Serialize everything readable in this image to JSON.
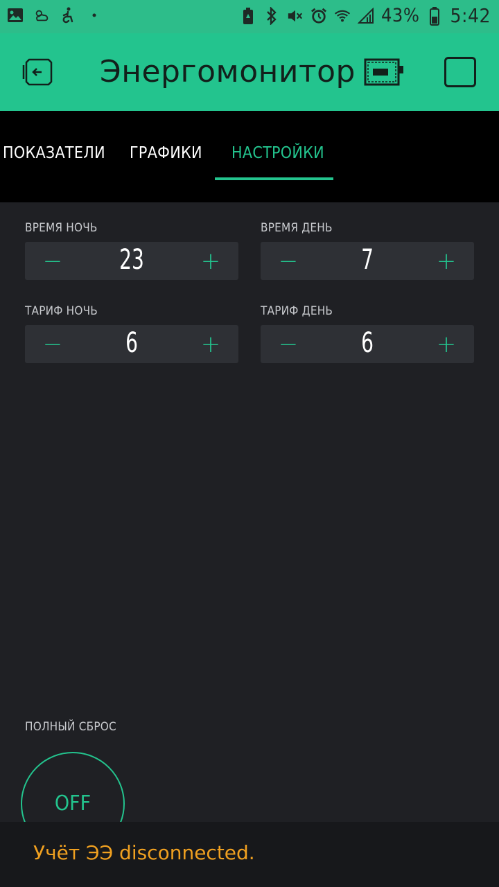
{
  "status_bar": {
    "left_icons": [
      "image-icon",
      "weather-icon",
      "accessibility-icon",
      "dot-icon"
    ],
    "right_icons": [
      "battery-saver-icon",
      "bluetooth-icon",
      "mute-icon",
      "alarm-icon",
      "wifi-icon",
      "signal-icon"
    ],
    "battery": "43%",
    "time": "5:42"
  },
  "app_bar": {
    "title": "Энергомонитор"
  },
  "tabs": [
    {
      "label": "ПОКАЗАТЕЛИ",
      "active": false
    },
    {
      "label": "ГРАФИКИ",
      "active": false
    },
    {
      "label": "НАСТРОЙКИ",
      "active": true
    }
  ],
  "settings": {
    "time_night": {
      "label": "ВРЕМЯ НОЧЬ",
      "value": "23",
      "minus": "−",
      "plus": "+"
    },
    "time_day": {
      "label": "ВРЕМЯ ДЕНЬ",
      "value": "7",
      "minus": "−",
      "plus": "+"
    },
    "tariff_night": {
      "label": "ТАРИФ НОЧЬ",
      "value": "6",
      "minus": "−",
      "plus": "+"
    },
    "tariff_day": {
      "label": "ТАРИФ ДЕНЬ",
      "value": "6",
      "minus": "−",
      "plus": "+"
    }
  },
  "reset": {
    "label": "ПОЛНЫЙ СБРОС",
    "button_label": "OFF"
  },
  "snackbar": {
    "message": "Учёт ЭЭ disconnected."
  },
  "colors": {
    "accent": "#23c48e",
    "background": "#1f2024",
    "stepper_bg": "#2e3035",
    "warning": "#f0a020"
  }
}
